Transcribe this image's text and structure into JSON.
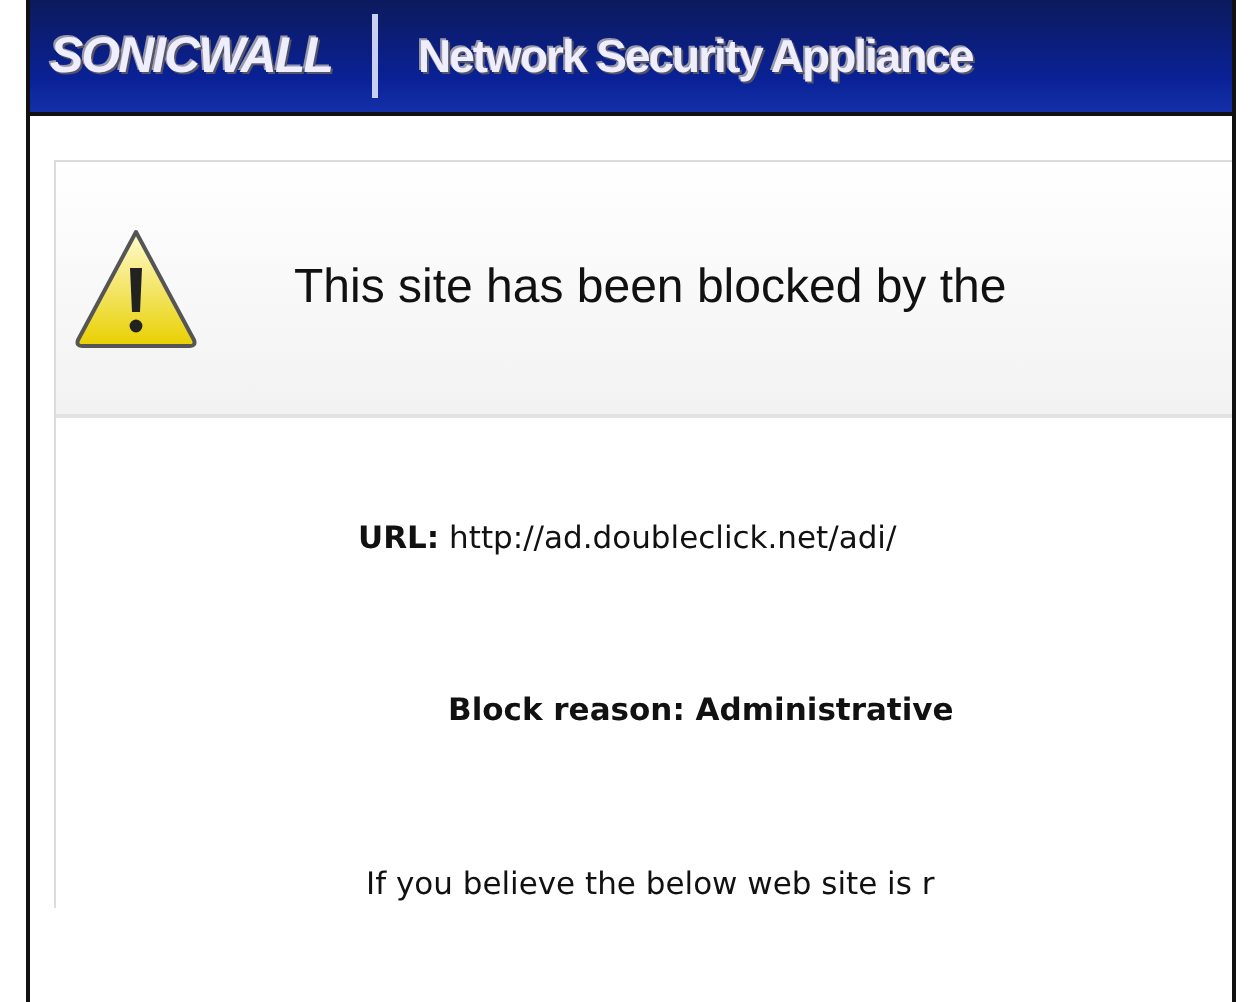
{
  "header": {
    "logo": "SONICWALL",
    "title": "Network Security Appliance"
  },
  "banner": {
    "message": "This site has been blocked by the"
  },
  "details": [
    {
      "kind": "url",
      "label": "URL:",
      "value": "http://ad.doubleclick.net/adi/"
    },
    {
      "kind": "reason",
      "label": "Block reason:",
      "value": "Administrative"
    },
    {
      "kind": "note",
      "value": "If you believe the below web site is r"
    }
  ]
}
